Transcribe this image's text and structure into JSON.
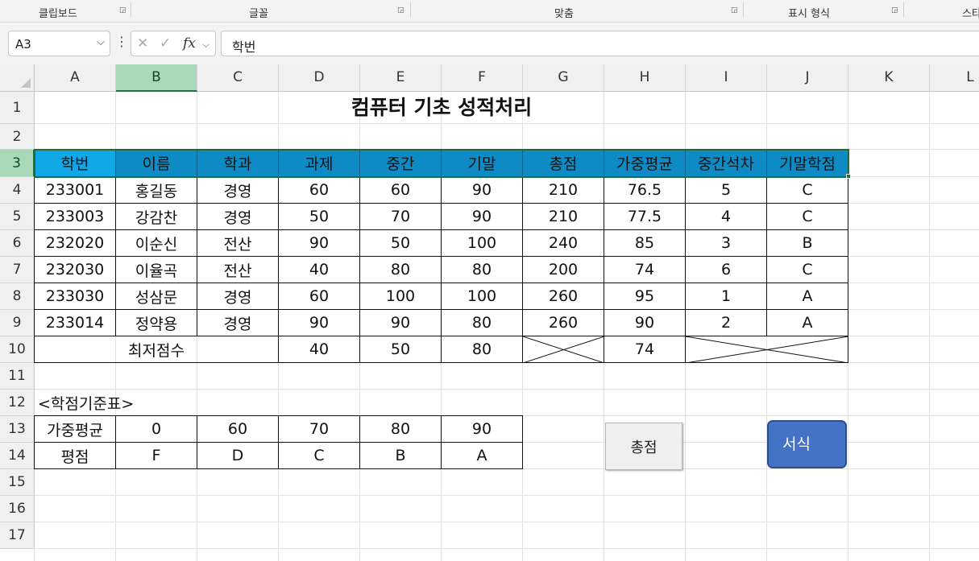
{
  "ribbon": {
    "groups": [
      {
        "label": "클립보드"
      },
      {
        "label": "글꼴"
      },
      {
        "label": "맞춤"
      },
      {
        "label": "표시 형식"
      },
      {
        "label": "스타"
      }
    ]
  },
  "formula_bar": {
    "name_box": "A3",
    "formula": "학번"
  },
  "columns": [
    "A",
    "B",
    "C",
    "D",
    "E",
    "F",
    "G",
    "H",
    "I",
    "J",
    "K",
    "L"
  ],
  "rows": [
    "1",
    "2",
    "3",
    "4",
    "5",
    "6",
    "7",
    "8",
    "9",
    "10",
    "11",
    "12",
    "13",
    "14",
    "15",
    "16",
    "17"
  ],
  "sheet": {
    "title": "컴퓨터 기초 성적처리",
    "headers": [
      "학번",
      "이름",
      "학과",
      "과제",
      "중간",
      "기말",
      "총점",
      "가중평균",
      "중간석차",
      "기말학점"
    ],
    "records": [
      [
        "233001",
        "홍길동",
        "경영",
        "60",
        "60",
        "90",
        "210",
        "76.5",
        "5",
        "C"
      ],
      [
        "233003",
        "강감찬",
        "경영",
        "50",
        "70",
        "90",
        "210",
        "77.5",
        "4",
        "C"
      ],
      [
        "232020",
        "이순신",
        "전산",
        "90",
        "50",
        "100",
        "240",
        "85",
        "3",
        "B"
      ],
      [
        "232030",
        "이율곡",
        "전산",
        "40",
        "80",
        "80",
        "200",
        "74",
        "6",
        "C"
      ],
      [
        "233030",
        "성삼문",
        "경영",
        "60",
        "100",
        "100",
        "260",
        "95",
        "1",
        "A"
      ],
      [
        "233014",
        "정약용",
        "경영",
        "90",
        "90",
        "80",
        "260",
        "90",
        "2",
        "A"
      ]
    ],
    "min_row": {
      "label": "최저점수",
      "values": [
        "40",
        "50",
        "80"
      ],
      "weighted": "74"
    },
    "grade_table": {
      "title": "<학점기준표>",
      "row1_label": "가중평균",
      "row1_values": [
        "0",
        "60",
        "70",
        "80",
        "90"
      ],
      "row2_label": "평점",
      "row2_values": [
        "F",
        "D",
        "C",
        "B",
        "A"
      ]
    }
  },
  "buttons": {
    "total": "총점",
    "format": "서식"
  },
  "colors": {
    "header_fill": "#0e8bc5",
    "active_cell_fill": "#12a7e6",
    "selection_green": "#217346",
    "format_button": "#4472c4"
  },
  "icons": {
    "launcher": "dialog-launcher-icon",
    "cancel": "cancel-x-icon",
    "enter": "check-icon",
    "function": "fx-icon"
  }
}
